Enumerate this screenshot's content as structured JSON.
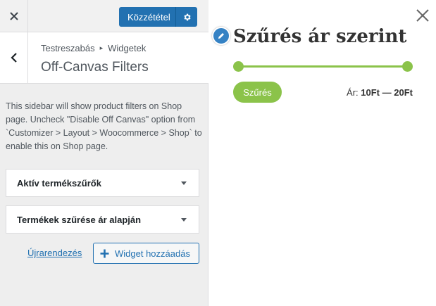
{
  "topbar": {
    "close_icon": "close-x-icon",
    "publish_label": "Közzététel",
    "settings_icon": "gear-icon"
  },
  "section": {
    "back_icon": "chevron-left-icon",
    "breadcrumb": [
      "Testreszabás",
      "Widgetek"
    ],
    "breadcrumb_separator_icon": "triangle-right-icon",
    "title": "Off-Canvas Filters",
    "description": "This sidebar will show product filters on Shop page. Uncheck \"Disable Off Canvas\" option from `Customizer > Layout > Woocommerce > Shop` to enable this on Shop page."
  },
  "widgets": [
    {
      "title": "Aktív termékszűrők"
    },
    {
      "title": "Termékek szűrése ár alapján"
    }
  ],
  "actions": {
    "reorder_label": "Újrarendezés",
    "add_widget_label": "Widget hozzáadás"
  },
  "preview": {
    "close_icon": "close-x-icon",
    "edit_icon": "pencil-icon",
    "heading": "Szűrés ár szerint",
    "filter_button": "Szűrés",
    "price_prefix": "Ár:",
    "price_min": "10Ft",
    "price_separator": "—",
    "price_max": "20Ft",
    "slider": {
      "min_fraction": 0.0,
      "max_fraction": 1.0
    }
  },
  "colors": {
    "accent_blue": "#2271b1",
    "slider_green": "#8bc34a",
    "sidebar_bg": "#eeeeee"
  }
}
